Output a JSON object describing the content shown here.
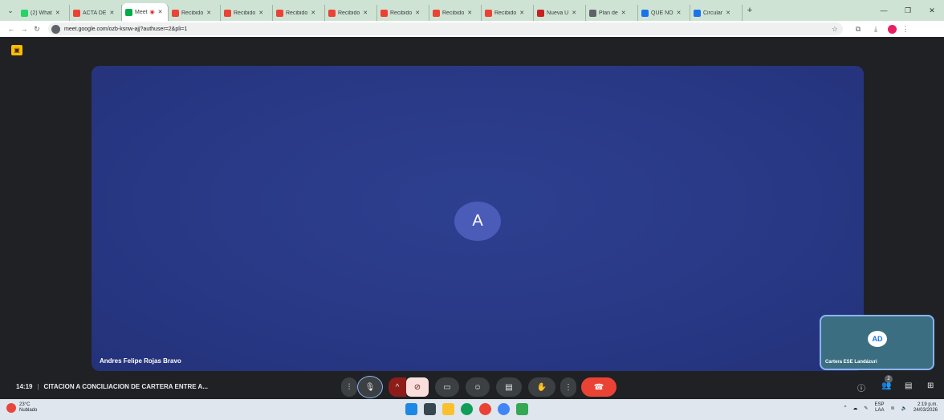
{
  "browser": {
    "tabs": [
      {
        "label": "(2) What",
        "color": "#25d366",
        "active": false
      },
      {
        "label": "ACTA DE",
        "color": "#ea4335",
        "active": false
      },
      {
        "label": "Meet",
        "color": "#00ac47",
        "active": true,
        "recording": true
      },
      {
        "label": "Recibido",
        "color": "#ea4335",
        "active": false
      },
      {
        "label": "Recibido",
        "color": "#ea4335",
        "active": false
      },
      {
        "label": "Recibido",
        "color": "#ea4335",
        "active": false
      },
      {
        "label": "Recibido",
        "color": "#ea4335",
        "active": false
      },
      {
        "label": "Recibido",
        "color": "#ea4335",
        "active": false
      },
      {
        "label": "Recibido",
        "color": "#ea4335",
        "active": false
      },
      {
        "label": "Recibido",
        "color": "#ea4335",
        "active": false
      },
      {
        "label": "Nueva U",
        "color": "#c5221f",
        "active": false
      },
      {
        "label": "Plan de",
        "color": "#5f6368",
        "active": false
      },
      {
        "label": "QUE NO",
        "color": "#1a73e8",
        "active": false
      },
      {
        "label": "Circular",
        "color": "#1a73e8",
        "active": false
      }
    ],
    "url": "meet.google.com/ozb-ksnw-ajj?authuser=2&pli=1"
  },
  "meet": {
    "main_tile": {
      "avatar_letter": "A",
      "participant_name": "Andres Felipe Rojas Bravo"
    },
    "self_view": {
      "participant_name": "Cartera ESE Landázuri",
      "logo_text": "AD"
    },
    "time": "14:19",
    "separator": "|",
    "meeting_title": "CITACION A CONCILIACION DE CARTERA ENTRE A...",
    "participants_count": "2",
    "colors": {
      "end_call": "#ea4335",
      "tile_bg": "#2a3a88",
      "camera_off": "#f9dedc"
    }
  },
  "taskbar": {
    "temperature": "23°C",
    "condition": "Nublado",
    "language_top": "ESP",
    "language_bottom": "LAA",
    "time": "2:19 p.m.",
    "date": "24/03/2026"
  }
}
